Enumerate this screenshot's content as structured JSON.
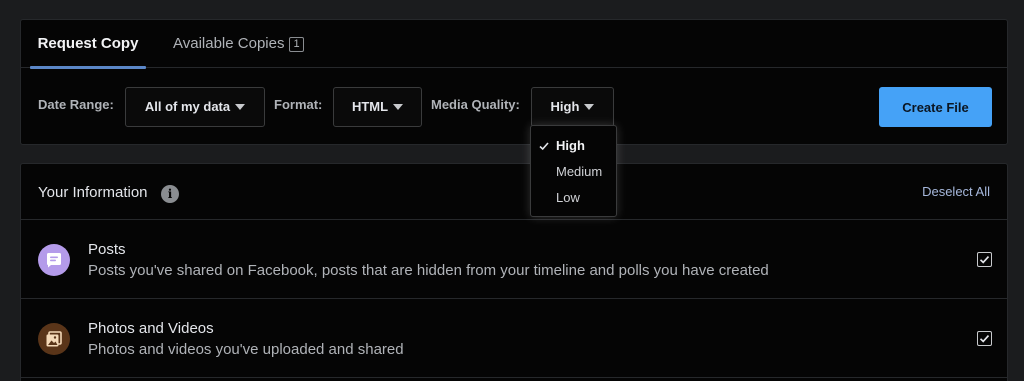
{
  "tabs": {
    "request": "Request Copy",
    "available": "Available Copies",
    "available_count": "1"
  },
  "filters": {
    "date_range_label": "Date Range:",
    "date_range_value": "All of my data",
    "format_label": "Format:",
    "format_value": "HTML",
    "quality_label": "Media Quality:",
    "quality_value": "High",
    "create_button": "Create File"
  },
  "quality_menu": {
    "options": [
      "High",
      "Medium",
      "Low"
    ],
    "selected": "High"
  },
  "info": {
    "title": "Your Information",
    "info_glyph": "i",
    "deselect": "Deselect All",
    "items": [
      {
        "title": "Posts",
        "desc": "Posts you've shared on Facebook, posts that are hidden from your timeline and polls you have created",
        "icon": "posts-icon",
        "icon_color": "#b49bea",
        "checked": true
      },
      {
        "title": "Photos and Videos",
        "desc": "Photos and videos you've uploaded and shared",
        "icon": "photos-icon",
        "icon_color": "#5a3519",
        "checked": true
      }
    ]
  },
  "colors": {
    "accent": "#45a2f7",
    "tab_underline": "#5b87c8",
    "link": "#a6b8dc"
  }
}
